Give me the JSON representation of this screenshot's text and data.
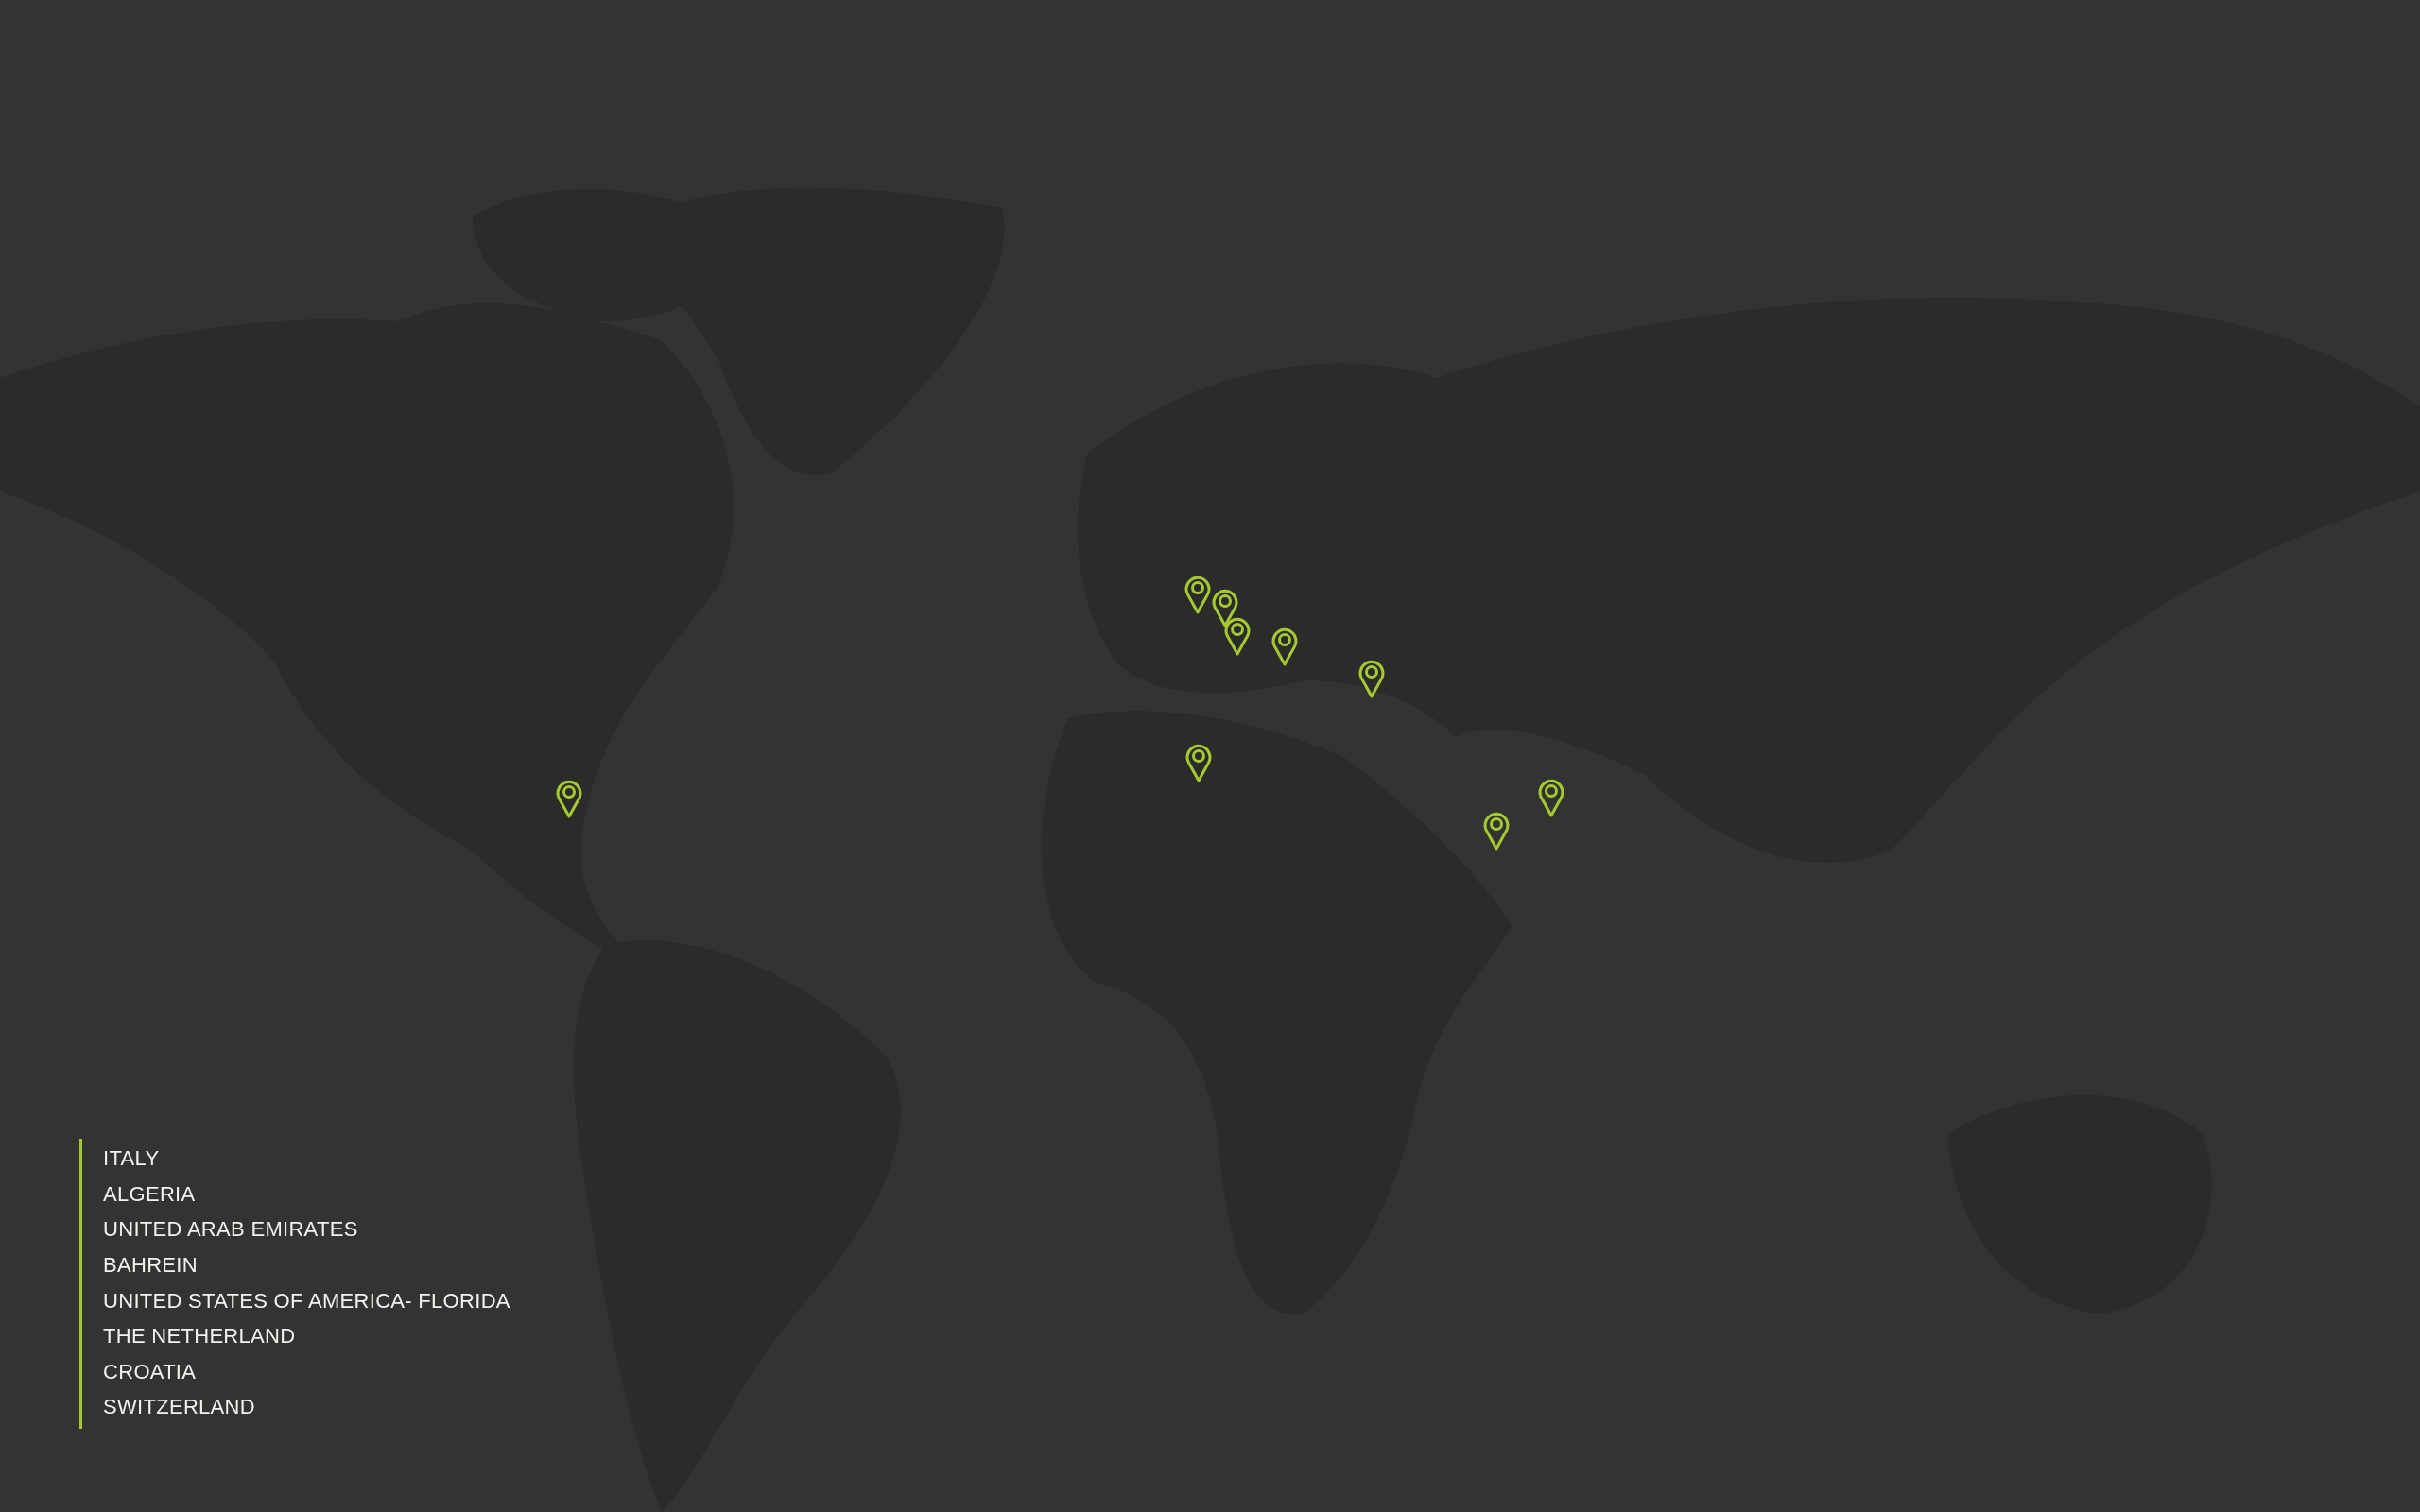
{
  "countries": [
    "ITALY",
    "ALGERIA",
    "UNITED ARAB EMIRATES",
    "BAHREIN",
    "UNITED STATES OF AMERICA- FLORIDA",
    "THE NETHERLAND",
    "CROATIA",
    "SWITZERLAND"
  ]
}
